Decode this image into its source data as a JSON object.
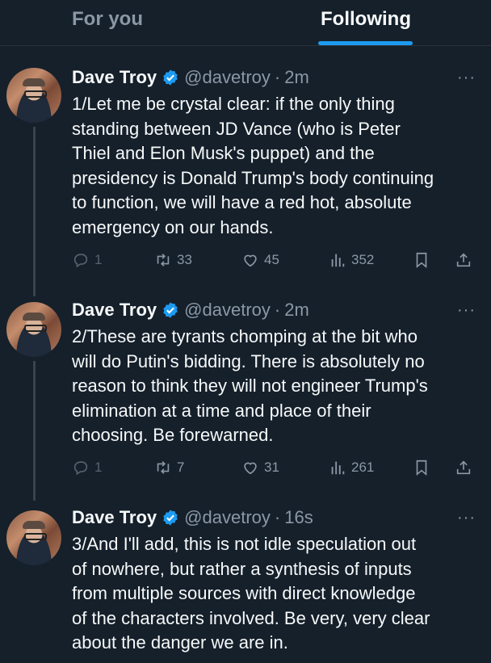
{
  "tabs": {
    "for_you": "For you",
    "following": "Following"
  },
  "colors": {
    "background": "#15202b",
    "accent": "#1d9bf0",
    "muted": "#8b98a5",
    "text": "#f7f9f9"
  },
  "tweets": [
    {
      "name": "Dave Troy",
      "handle": "@davetroy",
      "separator": "·",
      "time": "2m",
      "more": "···",
      "lines": [
        "1/Let me be crystal clear: if the only thing",
        "standing between JD Vance (who is Peter",
        "Thiel and Elon Musk's puppet) and the",
        "presidency is Donald Trump's body continuing",
        "to function, we will have a red hot, absolute",
        "emergency on our hands."
      ],
      "replies": "1",
      "retweets": "33",
      "likes": "45",
      "views": "352"
    },
    {
      "name": "Dave Troy",
      "handle": "@davetroy",
      "separator": "·",
      "time": "2m",
      "more": "···",
      "lines": [
        "2/These are tyrants chomping at the bit who",
        "will do Putin's bidding. There is absolutely no",
        "reason to think they will not engineer Trump's",
        "elimination at a time and place of their",
        "choosing. Be forewarned."
      ],
      "replies": "1",
      "retweets": "7",
      "likes": "31",
      "views": "261"
    },
    {
      "name": "Dave Troy",
      "handle": "@davetroy",
      "separator": "·",
      "time": "16s",
      "more": "···",
      "lines": [
        "3/And I'll add, this is not idle speculation out",
        "of nowhere, but rather a synthesis of inputs",
        "from multiple sources with direct knowledge",
        "of the characters involved. Be very, very clear",
        "about the danger we are in."
      ]
    }
  ]
}
